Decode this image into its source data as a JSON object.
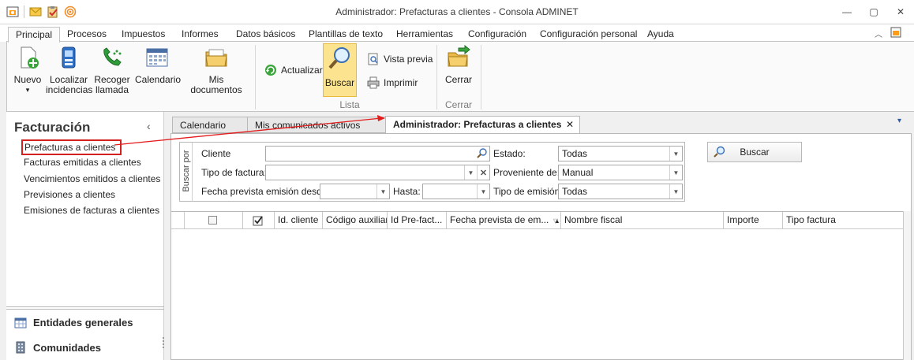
{
  "window": {
    "title": "Administrador: Prefacturas a clientes - Consola ADMINET",
    "minimize": "—",
    "maximize": "▢",
    "close": "✕"
  },
  "quick_access": [
    "app-icon",
    "mail-icon",
    "clipboard-icon",
    "signal-icon"
  ],
  "ribbon_tabs": [
    "Principal",
    "Procesos",
    "Impuestos",
    "Informes",
    "Datos básicos",
    "Plantillas de texto",
    "Herramientas",
    "Configuración",
    "Configuración personal",
    "Ayuda"
  ],
  "ribbon": {
    "nuevo": "Nuevo",
    "nuevo_arrow": "▾",
    "localizar": [
      "Localizar",
      "incidencias"
    ],
    "recoger": [
      "Recoger",
      "llamada"
    ],
    "calendario": "Calendario",
    "mis_documentos": "Mis documentos",
    "actualizar": "Actualizar",
    "buscar": "Buscar",
    "vista_previa": "Vista previa",
    "imprimir": "Imprimir",
    "lista_group": "Lista",
    "cerrar": "Cerrar",
    "cerrar_group": "Cerrar"
  },
  "left_panel": {
    "title": "Facturación",
    "collapse": "‹",
    "links": [
      "Prefacturas a clientes",
      "Facturas emitidas a clientes",
      "Vencimientos emitidos a clientes",
      "Previsiones a clientes",
      "Emisiones de facturas a clientes"
    ],
    "nav": [
      "Entidades generales",
      "Comunidades"
    ]
  },
  "doc_tabs": {
    "tab1": "Calendario",
    "tab2": "Mis comunicados activos",
    "active": "Administrador: Prefacturas a clientes",
    "close": "✕",
    "menu": "▾"
  },
  "filters": {
    "buscar_por": "Buscar por",
    "cliente_label": "Cliente",
    "cliente_value": "",
    "tipo_factura_label": "Tipo de factura:",
    "tipo_factura_value": "",
    "fecha_desde_label": "Fecha prevista emisión desde:",
    "fecha_desde_value": "",
    "hasta_label": "Hasta:",
    "hasta_value": "",
    "estado_label": "Estado:",
    "estado_value": "Todas",
    "proveniente_label": "Proveniente de:",
    "proveniente_value": "Manual",
    "tipo_emision_label": "Tipo de emisión:",
    "tipo_emision_value": "Todas",
    "buscar_button": "Buscar"
  },
  "grid": {
    "columns": [
      "Id. cliente",
      "Código auxiliar",
      "Id Pre-fact...",
      "Fecha prevista de em...",
      "Nombre fiscal",
      "Importe",
      "Tipo factura"
    ],
    "sort_indicator": "▲",
    "rows": []
  }
}
